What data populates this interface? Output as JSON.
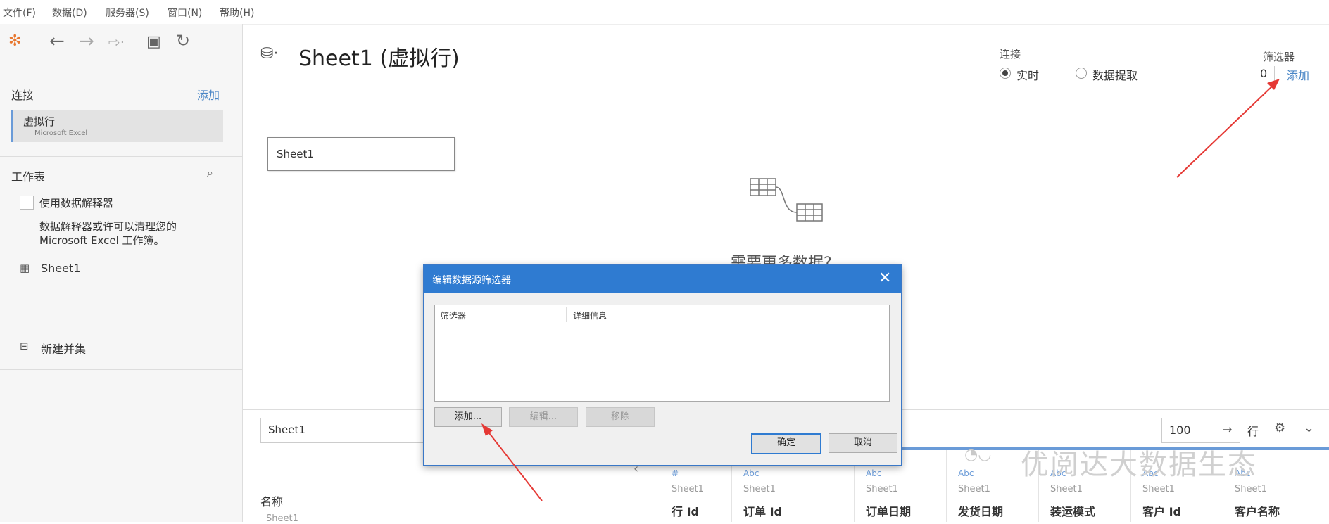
{
  "menu": [
    "文件(F)",
    "数据(D)",
    "服务器(S)",
    "窗口(N)",
    "帮助(H)"
  ],
  "left": {
    "connection_label": "连接",
    "add_label": "添加",
    "connection": {
      "name": "虚拟行",
      "type": "Microsoft Excel"
    },
    "worksheet_label": "工作表",
    "interpreter_checkbox": "使用数据解释器",
    "interpreter_hint_1": "数据解释器或许可以清理您的",
    "interpreter_hint_2": "Microsoft Excel 工作簿。",
    "sheet_item": "Sheet1",
    "new_union": "新建并集"
  },
  "header": {
    "title": "Sheet1 (虚拟行)",
    "connection_label": "连接",
    "live_label": "实时",
    "extract_label": "数据提取",
    "filter_label": "筛选器",
    "filter_count": "0",
    "filter_add": "添加"
  },
  "canvas": {
    "sheet_box": "Sheet1",
    "need_more_data": "需要更多数据?"
  },
  "bottom": {
    "sheet_field": "Sheet1",
    "rows_value": "100",
    "rows_label": "行",
    "name_label": "名称",
    "name_value": "Sheet1",
    "columns": [
      {
        "type": "#",
        "source": "Sheet1",
        "name": "行 Id"
      },
      {
        "type": "Abc",
        "source": "Sheet1",
        "name": "订单 Id"
      },
      {
        "type": "Abc",
        "source": "Sheet1",
        "name": "订单日期"
      },
      {
        "type": "Abc",
        "source": "Sheet1",
        "name": "发货日期"
      },
      {
        "type": "Abc",
        "source": "Sheet1",
        "name": "装运模式"
      },
      {
        "type": "Abc",
        "source": "Sheet1",
        "name": "客户 Id"
      },
      {
        "type": "Abc",
        "source": "Sheet1",
        "name": "客户名称"
      }
    ]
  },
  "dialog": {
    "title": "编辑数据源筛选器",
    "col_filter": "筛选器",
    "col_details": "详细信息",
    "add_button": "添加...",
    "edit_button": "编辑...",
    "remove_button": "移除",
    "ok_button": "确定",
    "cancel_button": "取消"
  },
  "watermark": "优阅达大数据生态",
  "colors": {
    "accent": "#2f7bd1",
    "arrow": "#e53935"
  }
}
